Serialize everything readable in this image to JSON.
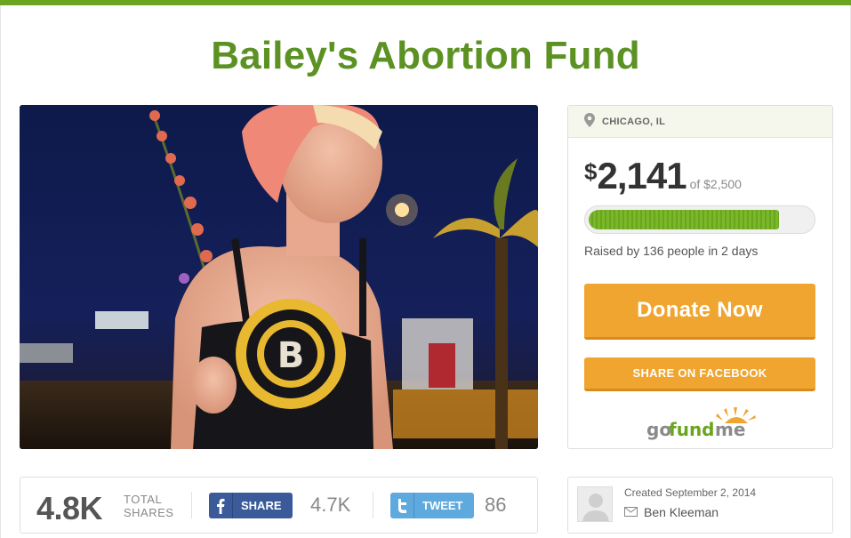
{
  "campaign": {
    "title": "Bailey's Abortion Fund"
  },
  "sidebar": {
    "location": "CHICAGO, IL",
    "amount_raised": "2,141",
    "currency_symbol": "$",
    "goal_text": "of $2,500",
    "progress": 0.856,
    "raised_text": "Raised by 136 people in 2 days",
    "donate_label": "Donate Now",
    "facebook_share_label": "SHARE ON FACEBOOK",
    "brand_logo_text": "gofundme"
  },
  "share_bar": {
    "total_shares": "4.8K",
    "total_label_line1": "TOTAL",
    "total_label_line2": "SHARES",
    "facebook_label": "SHARE",
    "facebook_count": "4.7K",
    "tweet_label": "TWEET",
    "tweet_count": "86"
  },
  "creator": {
    "created_text": "Created September 2, 2014",
    "organizer_name": "Ben Kleeman"
  },
  "icons": {
    "location": "map-pin-icon",
    "facebook": "facebook-icon",
    "twitter": "twitter-icon",
    "email": "envelope-icon",
    "avatar": "user-silhouette-icon"
  },
  "colors": {
    "brand_green": "#6aa51f",
    "title_green": "#5c9223",
    "donate_orange": "#f0a530",
    "facebook_blue": "#3b5a9a",
    "twitter_blue": "#5ea9dd"
  }
}
